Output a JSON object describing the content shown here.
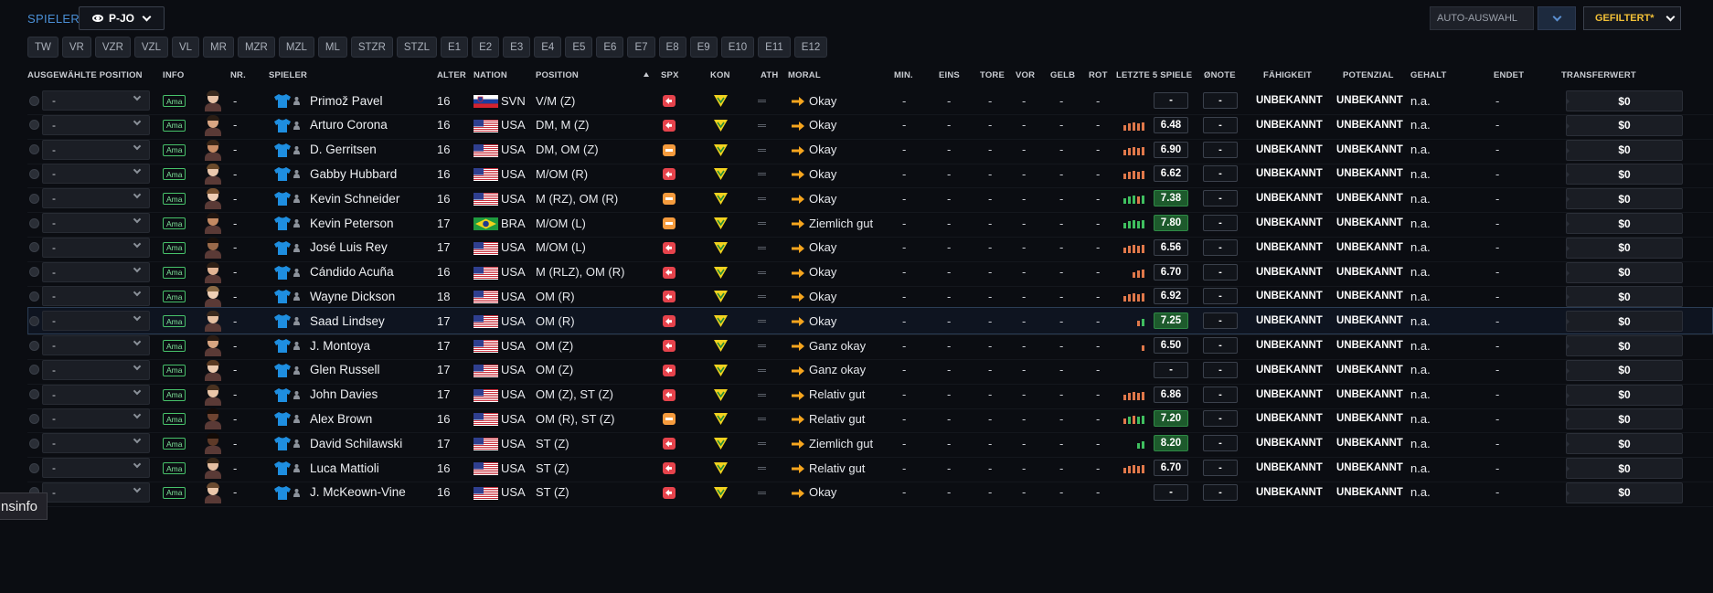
{
  "toolbar": {
    "spieler_label": "SPIELER",
    "view_value": "P-JO",
    "auto_label": "AUTO-AUSWAHL",
    "filter_label": "GEFILTERT*"
  },
  "position_filters": [
    "TW",
    "VR",
    "VZR",
    "VZL",
    "VL",
    "MR",
    "MZR",
    "MZL",
    "ML",
    "STZR",
    "STZL",
    "E1",
    "E2",
    "E3",
    "E4",
    "E5",
    "E6",
    "E7",
    "E8",
    "E9",
    "E10",
    "E11",
    "E12"
  ],
  "columns": {
    "pos": "AUSGEWÄHLTE POSITION",
    "info": "INFO",
    "nr": "NR.",
    "spieler": "SPIELER",
    "alter": "ALTER",
    "nation": "NATION",
    "position": "POSITION",
    "spx": "SPX",
    "kon": "KON",
    "ath": "ATH",
    "moral": "MORAL",
    "min": "MIN.",
    "eins": "EINS",
    "tore": "TORE",
    "vor": "VOR",
    "gelb": "GELB",
    "rot": "ROT",
    "last5": "LETZTE 5 SPIELE",
    "onote": "ØNOTE",
    "fahigkeit": "FÄHIGKEIT",
    "potenzial": "POTENZIAL",
    "gehalt": "GEHALT",
    "endet": "ENDET",
    "transferwert": "TRANSFERWERT"
  },
  "colors": {
    "accent_blue": "#4a8fd6",
    "filter_yellow": "#f2c037",
    "rating_green": "#3fbf5f",
    "rating_orange": "#e0784a",
    "spx_red": "#e6434c",
    "spx_orange": "#f59b3d"
  },
  "rows": [
    {
      "pos": "-",
      "info": "Ama",
      "nr": "-",
      "name": "Primož Pavel",
      "alter": "16",
      "flag": "SVN",
      "nation": "SVN",
      "position": "V/M (Z)",
      "spx": "red",
      "moral": "Okay",
      "min": "-",
      "eins": "-",
      "tore": "-",
      "vor": "-",
      "gelb": "-",
      "rot": "-",
      "last5": [],
      "rating": "-",
      "onote": "-",
      "fahigkeit": "UNBEKANNT",
      "potenzial": "UNBEKANNT",
      "gehalt": "n.a.",
      "endet": "-",
      "transferwert": "$0",
      "skin": "#e8c2a6",
      "hair": "#3a2a1e"
    },
    {
      "pos": "-",
      "info": "Ama",
      "nr": "-",
      "name": "Arturo Corona",
      "alter": "16",
      "flag": "USA",
      "nation": "USA",
      "position": "DM, M (Z)",
      "spx": "red",
      "moral": "Okay",
      "min": "-",
      "eins": "-",
      "tore": "-",
      "vor": "-",
      "gelb": "-",
      "rot": "-",
      "last5": [
        "o",
        "o",
        "o",
        "o",
        "o"
      ],
      "rating": "6.48",
      "onote": "-",
      "fahigkeit": "UNBEKANNT",
      "potenzial": "UNBEKANNT",
      "gehalt": "n.a.",
      "endet": "-",
      "transferwert": "$0",
      "skin": "#d9a684",
      "hair": "#2a1d14"
    },
    {
      "pos": "-",
      "info": "Ama",
      "nr": "-",
      "name": "D. Gerritsen",
      "alter": "16",
      "flag": "USA",
      "nation": "USA",
      "position": "DM, OM (Z)",
      "spx": "orange",
      "moral": "Okay",
      "min": "-",
      "eins": "-",
      "tore": "-",
      "vor": "-",
      "gelb": "-",
      "rot": "-",
      "last5": [
        "o",
        "o",
        "o",
        "o",
        "o"
      ],
      "rating": "6.90",
      "onote": "-",
      "fahigkeit": "UNBEKANNT",
      "potenzial": "UNBEKANNT",
      "gehalt": "n.a.",
      "endet": "-",
      "transferwert": "$0",
      "skin": "#c98d66",
      "hair": "#3a2617"
    },
    {
      "pos": "-",
      "info": "Ama",
      "nr": "-",
      "name": "Gabby Hubbard",
      "alter": "16",
      "flag": "USA",
      "nation": "USA",
      "position": "M/OM (R)",
      "spx": "red",
      "moral": "Okay",
      "min": "-",
      "eins": "-",
      "tore": "-",
      "vor": "-",
      "gelb": "-",
      "rot": "-",
      "last5": [
        "o",
        "o",
        "o",
        "o",
        "o"
      ],
      "rating": "6.62",
      "onote": "-",
      "fahigkeit": "UNBEKANNT",
      "potenzial": "UNBEKANNT",
      "gehalt": "n.a.",
      "endet": "-",
      "transferwert": "$0",
      "skin": "#ecc9ae",
      "hair": "#6b4a2a"
    },
    {
      "pos": "-",
      "info": "Ama",
      "nr": "-",
      "name": "Kevin Schneider",
      "alter": "16",
      "flag": "USA",
      "nation": "USA",
      "position": "M (RZ), OM (R)",
      "spx": "orange",
      "moral": "Okay",
      "min": "-",
      "eins": "-",
      "tore": "-",
      "vor": "-",
      "gelb": "-",
      "rot": "-",
      "last5": [
        "g",
        "g",
        "g",
        "o",
        "g"
      ],
      "rating": "7.38",
      "onote": "-",
      "fahigkeit": "UNBEKANNT",
      "potenzial": "UNBEKANNT",
      "gehalt": "n.a.",
      "endet": "-",
      "transferwert": "$0",
      "skin": "#efcdb3",
      "hair": "#7a5230"
    },
    {
      "pos": "-",
      "info": "Ama",
      "nr": "-",
      "name": "Kevin Peterson",
      "alter": "17",
      "flag": "BRA",
      "nation": "BRA",
      "position": "M/OM (L)",
      "spx": "orange",
      "moral": "Ziemlich gut",
      "min": "-",
      "eins": "-",
      "tore": "-",
      "vor": "-",
      "gelb": "-",
      "rot": "-",
      "last5": [
        "g",
        "g",
        "g",
        "g",
        "g"
      ],
      "rating": "7.80",
      "onote": "-",
      "fahigkeit": "UNBEKANNT",
      "potenzial": "UNBEKANNT",
      "gehalt": "n.a.",
      "endet": "-",
      "transferwert": "$0",
      "skin": "#c48a63",
      "hair": "#201510"
    },
    {
      "pos": "-",
      "info": "Ama",
      "nr": "-",
      "name": "José Luis Rey",
      "alter": "17",
      "flag": "USA",
      "nation": "USA",
      "position": "M/OM (L)",
      "spx": "red",
      "moral": "Okay",
      "min": "-",
      "eins": "-",
      "tore": "-",
      "vor": "-",
      "gelb": "-",
      "rot": "-",
      "last5": [
        "o",
        "o",
        "o",
        "o",
        "o"
      ],
      "rating": "6.56",
      "onote": "-",
      "fahigkeit": "UNBEKANNT",
      "potenzial": "UNBEKANNT",
      "gehalt": "n.a.",
      "endet": "-",
      "transferwert": "$0",
      "skin": "#9a6a4a",
      "hair": "#1a110b"
    },
    {
      "pos": "-",
      "info": "Ama",
      "nr": "-",
      "name": "Cándido Acuña",
      "alter": "16",
      "flag": "USA",
      "nation": "USA",
      "position": "M (RLZ), OM (R)",
      "spx": "red",
      "moral": "Okay",
      "min": "-",
      "eins": "-",
      "tore": "-",
      "vor": "-",
      "gelb": "-",
      "rot": "-",
      "last5": [
        "o",
        "o",
        "o"
      ],
      "rating": "6.70",
      "onote": "-",
      "fahigkeit": "UNBEKANNT",
      "potenzial": "UNBEKANNT",
      "gehalt": "n.a.",
      "endet": "-",
      "transferwert": "$0",
      "skin": "#e2b595",
      "hair": "#2e1f15"
    },
    {
      "pos": "-",
      "info": "Ama",
      "nr": "-",
      "name": "Wayne Dickson",
      "alter": "18",
      "flag": "USA",
      "nation": "USA",
      "position": "OM (R)",
      "spx": "red",
      "moral": "Okay",
      "min": "-",
      "eins": "-",
      "tore": "-",
      "vor": "-",
      "gelb": "-",
      "rot": "-",
      "last5": [
        "o",
        "o",
        "o",
        "o",
        "o"
      ],
      "rating": "6.92",
      "onote": "-",
      "fahigkeit": "UNBEKANNT",
      "potenzial": "UNBEKANNT",
      "gehalt": "n.a.",
      "endet": "-",
      "transferwert": "$0",
      "skin": "#efd0b6",
      "hair": "#8a6a45"
    },
    {
      "pos": "-",
      "info": "Ama",
      "nr": "-",
      "name": "Saad Lindsey",
      "alter": "17",
      "flag": "USA",
      "nation": "USA",
      "position": "OM (R)",
      "spx": "red",
      "moral": "Okay",
      "min": "-",
      "eins": "-",
      "tore": "-",
      "vor": "-",
      "gelb": "-",
      "rot": "-",
      "last5": [
        "o",
        "g"
      ],
      "rating": "7.25",
      "onote": "-",
      "fahigkeit": "UNBEKANNT",
      "potenzial": "UNBEKANNT",
      "gehalt": "n.a.",
      "endet": "-",
      "transferwert": "$0",
      "skin": "#e6c0a2",
      "hair": "#3a2a1e",
      "selected": true
    },
    {
      "pos": "-",
      "info": "Ama",
      "nr": "-",
      "name": "J. Montoya",
      "alter": "17",
      "flag": "USA",
      "nation": "USA",
      "position": "OM (Z)",
      "spx": "red",
      "moral": "Ganz okay",
      "min": "-",
      "eins": "-",
      "tore": "-",
      "vor": "-",
      "gelb": "-",
      "rot": "-",
      "last5": [
        "o"
      ],
      "rating": "6.50",
      "onote": "-",
      "fahigkeit": "UNBEKANNT",
      "potenzial": "UNBEKANNT",
      "gehalt": "n.a.",
      "endet": "-",
      "transferwert": "$0",
      "skin": "#d8a582",
      "hair": "#2a1b12"
    },
    {
      "pos": "-",
      "info": "Ama",
      "nr": "-",
      "name": "Glen Russell",
      "alter": "17",
      "flag": "USA",
      "nation": "USA",
      "position": "OM (Z)",
      "spx": "red",
      "moral": "Ganz okay",
      "min": "-",
      "eins": "-",
      "tore": "-",
      "vor": "-",
      "gelb": "-",
      "rot": "-",
      "last5": [],
      "rating": "-",
      "onote": "-",
      "fahigkeit": "UNBEKANNT",
      "potenzial": "UNBEKANNT",
      "gehalt": "n.a.",
      "endet": "-",
      "transferwert": "$0",
      "skin": "#eccbb0",
      "hair": "#5a3a22"
    },
    {
      "pos": "-",
      "info": "Ama",
      "nr": "-",
      "name": "John Davies",
      "alter": "17",
      "flag": "USA",
      "nation": "USA",
      "position": "OM (Z), ST (Z)",
      "spx": "red",
      "moral": "Relativ gut",
      "min": "-",
      "eins": "-",
      "tore": "-",
      "vor": "-",
      "gelb": "-",
      "rot": "-",
      "last5": [
        "o",
        "o",
        "o",
        "o",
        "o"
      ],
      "rating": "6.86",
      "onote": "-",
      "fahigkeit": "UNBEKANNT",
      "potenzial": "UNBEKANNT",
      "gehalt": "n.a.",
      "endet": "-",
      "transferwert": "$0",
      "skin": "#e9c5a8",
      "hair": "#4a3220"
    },
    {
      "pos": "-",
      "info": "Ama",
      "nr": "-",
      "name": "Alex Brown",
      "alter": "16",
      "flag": "USA",
      "nation": "USA",
      "position": "OM (R), ST (Z)",
      "spx": "orange",
      "moral": "Relativ gut",
      "min": "-",
      "eins": "-",
      "tore": "-",
      "vor": "-",
      "gelb": "-",
      "rot": "-",
      "last5": [
        "o",
        "g",
        "o",
        "g",
        "g"
      ],
      "rating": "7.20",
      "onote": "-",
      "fahigkeit": "UNBEKANNT",
      "potenzial": "UNBEKANNT",
      "gehalt": "n.a.",
      "endet": "-",
      "transferwert": "$0",
      "skin": "#6e4330",
      "hair": "#140c08"
    },
    {
      "pos": "-",
      "info": "Ama",
      "nr": "-",
      "name": "David Schilawski",
      "alter": "17",
      "flag": "USA",
      "nation": "USA",
      "position": "ST (Z)",
      "spx": "red",
      "moral": "Ziemlich gut",
      "min": "-",
      "eins": "-",
      "tore": "-",
      "vor": "-",
      "gelb": "-",
      "rot": "-",
      "last5": [
        "g",
        "g"
      ],
      "rating": "8.20",
      "onote": "-",
      "fahigkeit": "UNBEKANNT",
      "potenzial": "UNBEKANNT",
      "gehalt": "n.a.",
      "endet": "-",
      "transferwert": "$0",
      "skin": "#5e3a28",
      "hair": "#120a06"
    },
    {
      "pos": "-",
      "info": "Ama",
      "nr": "-",
      "name": "Luca Mattioli",
      "alter": "16",
      "flag": "USA",
      "nation": "USA",
      "position": "ST (Z)",
      "spx": "red",
      "moral": "Relativ gut",
      "min": "-",
      "eins": "-",
      "tore": "-",
      "vor": "-",
      "gelb": "-",
      "rot": "-",
      "last5": [
        "o",
        "o",
        "o",
        "o",
        "o"
      ],
      "rating": "6.70",
      "onote": "-",
      "fahigkeit": "UNBEKANNT",
      "potenzial": "UNBEKANNT",
      "gehalt": "n.a.",
      "endet": "-",
      "transferwert": "$0",
      "skin": "#e5bea0",
      "hair": "#3a2818"
    },
    {
      "pos": "-",
      "info": "Ama",
      "nr": "-",
      "name": "J. McKeown-Vine",
      "alter": "16",
      "flag": "USA",
      "nation": "USA",
      "position": "ST (Z)",
      "spx": "red",
      "moral": "Okay",
      "min": "-",
      "eins": "-",
      "tore": "-",
      "vor": "-",
      "gelb": "-",
      "rot": "-",
      "last5": [],
      "rating": "-",
      "onote": "-",
      "fahigkeit": "UNBEKANNT",
      "potenzial": "UNBEKANNT",
      "gehalt": "n.a.",
      "endet": "-",
      "transferwert": "$0",
      "skin": "#ecc8ab",
      "hair": "#6a4a30"
    }
  ],
  "tooltip": "nsinfo"
}
